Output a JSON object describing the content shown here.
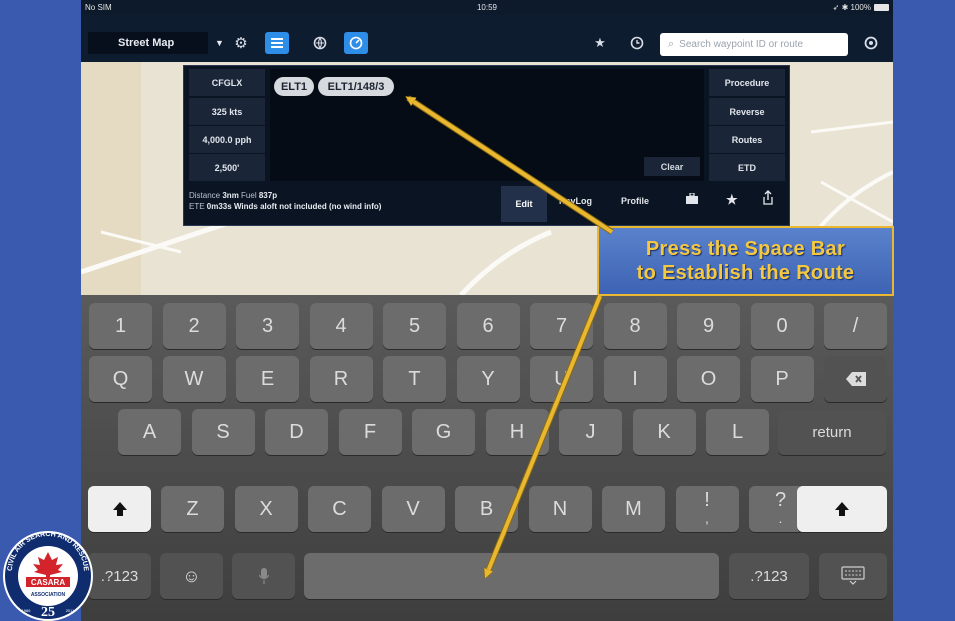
{
  "status_bar": {
    "carrier": "No SIM",
    "time": "10:59",
    "battery": "100%"
  },
  "toolbar": {
    "map_style": "Street Map",
    "search_placeholder": "Search waypoint ID or route"
  },
  "flight_plan": {
    "left_fields": [
      "CFGLX",
      "325 kts",
      "4,000.0 pph",
      "2,500'"
    ],
    "right_buttons": [
      "Procedure",
      "Reverse",
      "Routes",
      "ETD"
    ],
    "route_chips": [
      "ELT1",
      "ELT1/148/3"
    ],
    "clear_label": "Clear",
    "distance_label": "Distance",
    "distance_value": "3nm",
    "fuel_label": "Fuel",
    "fuel_value": "837p",
    "ete_label": "ETE",
    "ete_value": "0m33s",
    "winds_text": "Winds aloft not included (no wind info)",
    "tabs": {
      "edit": "Edit",
      "navlog": "NavLog",
      "profile": "Profile"
    }
  },
  "callout": {
    "line1": "Press the Space Bar",
    "line2": "to Establish the Route"
  },
  "keyboard": {
    "row_numbers": [
      "1",
      "2",
      "3",
      "4",
      "5",
      "6",
      "7",
      "8",
      "9",
      "0",
      "/"
    ],
    "row_qwerty": [
      "Q",
      "W",
      "E",
      "R",
      "T",
      "Y",
      "U",
      "I",
      "O",
      "P"
    ],
    "row_asdf": [
      "A",
      "S",
      "D",
      "F",
      "G",
      "H",
      "J",
      "K",
      "L"
    ],
    "row_zxcv": [
      "Z",
      "X",
      "C",
      "V",
      "B",
      "N",
      "M",
      "!",
      "?"
    ],
    "row_zxcv_sub": [
      ",",
      "."
    ],
    "return_label": "return",
    "numbers_label": ".?123"
  },
  "logo": {
    "top_text": "CIVIL AIR SEARCH AND RESCUE",
    "name": "CASARA",
    "bottom_text": "ASSOCIATION",
    "years": "25",
    "year_start": "1986",
    "year_end": "2011"
  },
  "colors": {
    "background": "#3a5ab0",
    "callout_text": "#f5c842",
    "arrow": "#e9b730"
  }
}
